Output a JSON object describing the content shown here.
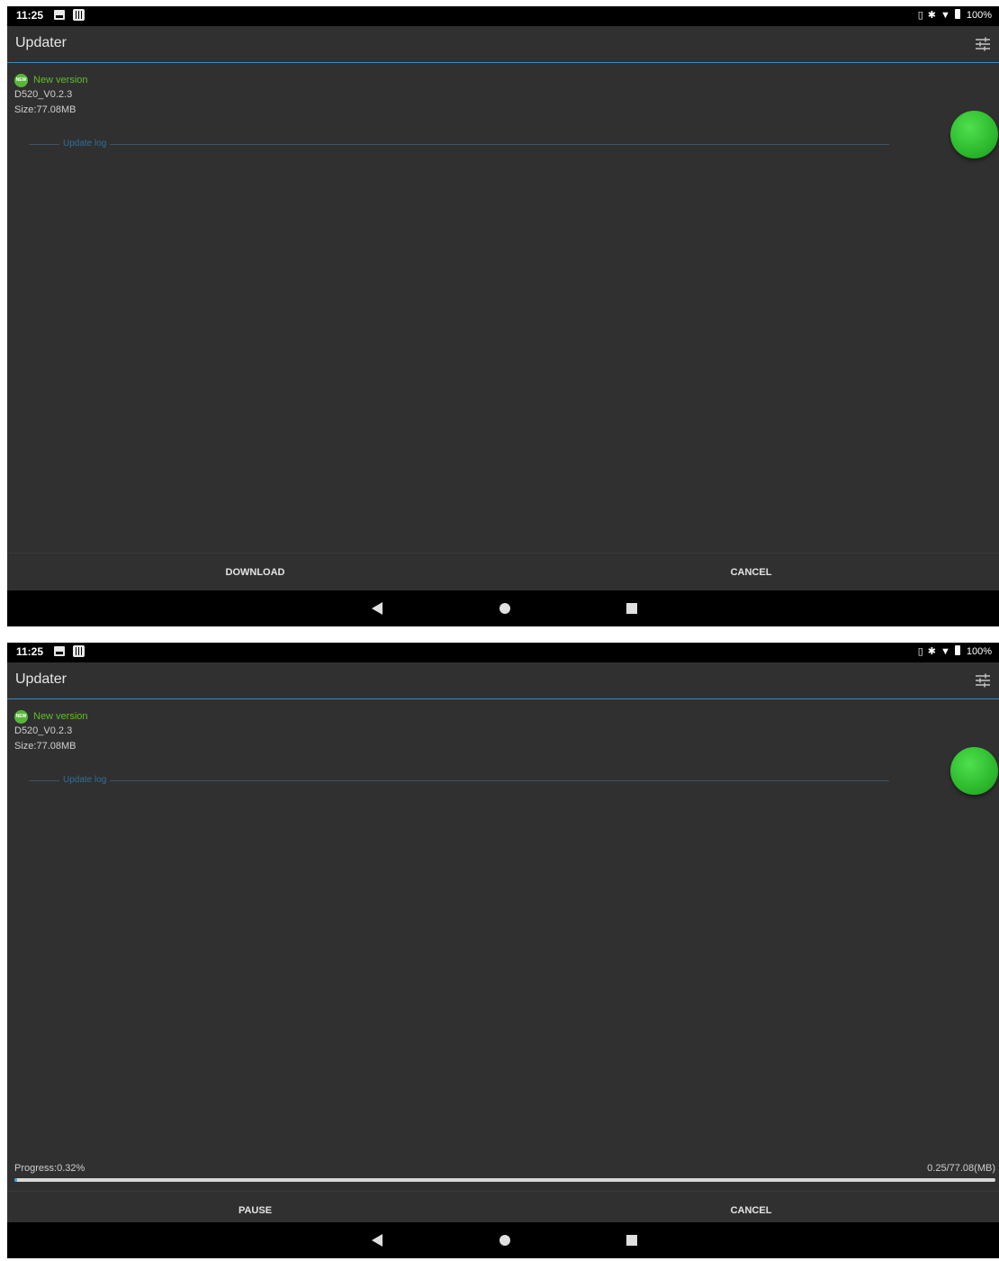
{
  "screens": [
    {
      "status_bar": {
        "time": "11:25",
        "battery": "100%"
      },
      "app_bar": {
        "title": "Updater"
      },
      "version": {
        "badge": "NEW",
        "label": "New version",
        "name": "D520_V0.2.3",
        "size": "Size:77.08MB"
      },
      "update_log_label": "Update log",
      "buttons": {
        "primary": "DOWNLOAD",
        "secondary": "CANCEL"
      }
    },
    {
      "status_bar": {
        "time": "11:25",
        "battery": "100%"
      },
      "app_bar": {
        "title": "Updater"
      },
      "version": {
        "badge": "NEW",
        "label": "New version",
        "name": "D520_V0.2.3",
        "size": "Size:77.08MB"
      },
      "update_log_label": "Update log",
      "progress": {
        "label": "Progress:0.32%",
        "amount": "0.25/77.08(MB)",
        "percent": 0.32
      },
      "buttons": {
        "primary": "PAUSE",
        "secondary": "CANCEL"
      }
    }
  ],
  "colors": {
    "background": "#303030",
    "accent": "#3a8bbd",
    "new_label": "#5fbf2a",
    "indicator": "#2fbd2f"
  },
  "icons": [
    "photo-notification-icon",
    "sd-card-icon",
    "sim-icon",
    "bluetooth-icon",
    "wifi-icon",
    "battery-icon",
    "settings-sliders-icon",
    "new-badge-icon",
    "back-icon",
    "home-icon",
    "recents-icon"
  ]
}
